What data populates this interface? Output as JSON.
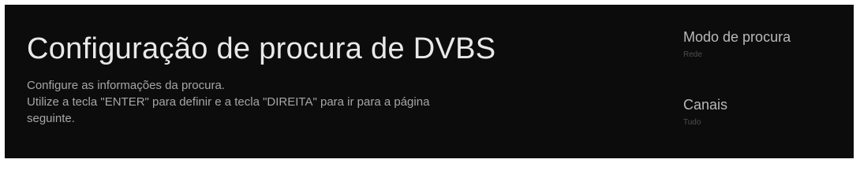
{
  "header": {
    "title": "Configuração de procura de DVBS"
  },
  "description": {
    "line1": "Configure as informações da procura.",
    "line2": "Utilize a tecla \"ENTER\" para definir e a tecla \"DIREITA\" para ir para a página",
    "line3": "seguinte."
  },
  "settings": {
    "items": [
      {
        "label": "Modo de procura",
        "value": "Rede"
      },
      {
        "label": "Canais",
        "value": "Tudo"
      }
    ]
  },
  "colors": {
    "background": "#0c0c0c",
    "title": "#e9e9e9",
    "text": "#a6a6a6",
    "value": "#4e4e4e"
  }
}
